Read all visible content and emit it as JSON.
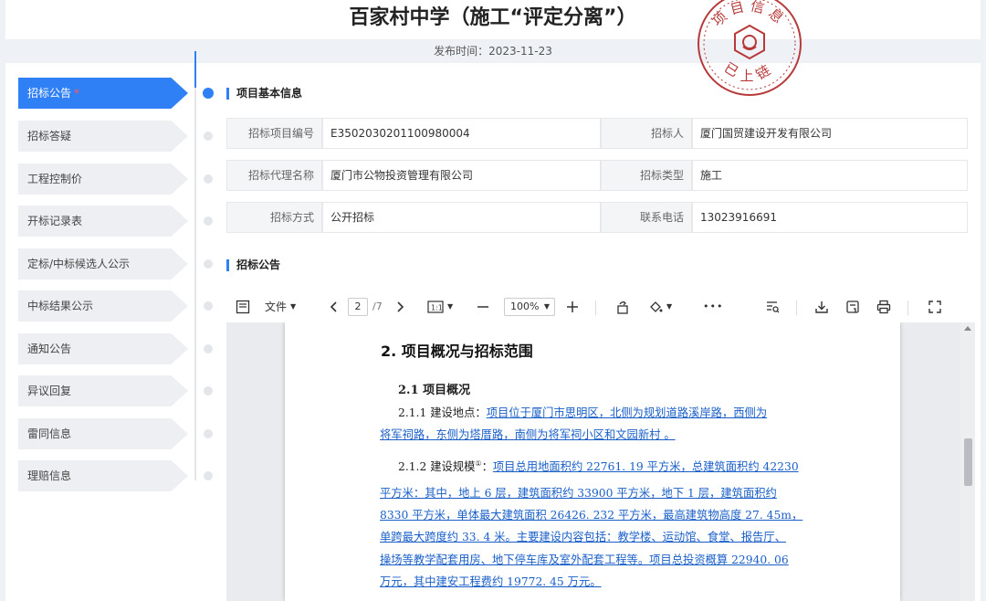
{
  "header": {
    "title": "百家村中学（施工“评定分离”）",
    "publish_time": "发布时间：2023-11-23"
  },
  "seal": {
    "top_text": "项目信息",
    "bottom_text": "已上链",
    "color": "#b73a3a"
  },
  "sidebar": {
    "items": [
      {
        "label": "招标公告",
        "active": true,
        "star": "*"
      },
      {
        "label": "招标答疑"
      },
      {
        "label": "工程控制价"
      },
      {
        "label": "开标记录表"
      },
      {
        "label": "定标/中标候选人公示"
      },
      {
        "label": "中标结果公示"
      },
      {
        "label": "通知公告"
      },
      {
        "label": "异议回复"
      },
      {
        "label": "雷同信息"
      },
      {
        "label": "理赔信息"
      }
    ]
  },
  "basic_info": {
    "section_title": "项目基本信息",
    "rows": [
      [
        {
          "label": "招标项目编号",
          "value": "E3502030201100980004"
        },
        {
          "label": "招标人",
          "value": "厦门国贸建设开发有限公司"
        }
      ],
      [
        {
          "label": "招标代理名称",
          "value": "厦门市公物投资管理有限公司"
        },
        {
          "label": "招标类型",
          "value": "施工"
        }
      ],
      [
        {
          "label": "招标方式",
          "value": "公开招标"
        },
        {
          "label": "联系电话",
          "value": "13023916691"
        }
      ]
    ]
  },
  "notice": {
    "section_title": "招标公告"
  },
  "pdf_toolbar": {
    "file_label": "文件",
    "current_page": "2",
    "total_pages": "/7",
    "zoom": "100%",
    "more": "•••",
    "icons": [
      "sidebar-toggle-icon",
      "chevron-left-icon",
      "chevron-right-icon",
      "fit-page-icon",
      "zoom-out-icon",
      "zoom-in-icon",
      "rotate-icon",
      "fill-color-icon",
      "search-icon",
      "download-icon",
      "save-icon",
      "print-icon",
      "fullscreen-icon"
    ]
  },
  "document": {
    "heading": "2. 项目概况与招标范围",
    "subheading": "2.1 项目概况",
    "p1_prefix": "2.1.1 建设地点：",
    "p1_line1": "项目位于厦门市思明区，北侧为规划道路溪岸路，西侧为",
    "p1_line2": "将军祠路，东侧为塔厝路，南侧为将军祠小区和文园新村 。",
    "p2_prefix": "2.1.2 建设规模",
    "p2_sup": "①",
    "p2_colon": "：",
    "p2_line1": "项目总用地面积约 22761. 19 平方米，总建筑面积约 42230",
    "p2_line2": "平方米：其中，地上 6 层，建筑面积约 33900 平方米，地下 1 层，建筑面积约",
    "p2_line3": "8330 平方米，单体最大建筑面积 26426. 232 平方米，最高建筑物高度 27. 45m，",
    "p2_line4": "单跨最大跨度约 33. 4 米。主要建设内容包括：教学楼、运动馆、食堂、报告厅、",
    "p2_line5": "操场等教学配套用房、地下停车库及室外配套工程等。项目总投资概算 22940. 06",
    "p2_line6": "万元，其中建安工程费约 19772. 45 万元。"
  }
}
